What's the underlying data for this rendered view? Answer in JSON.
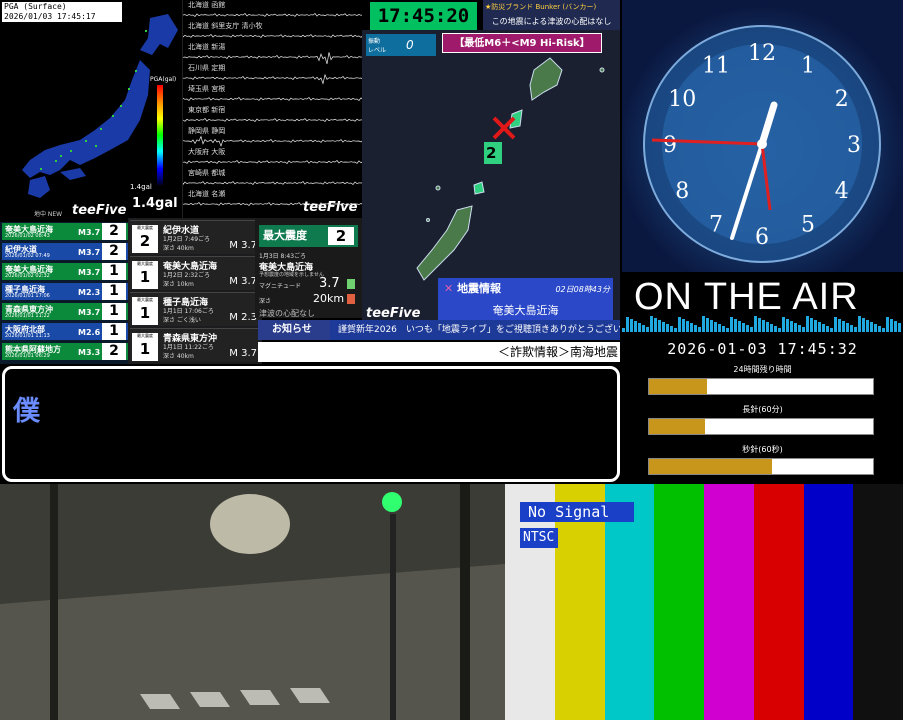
{
  "pga": {
    "label": "PGA (Surface)",
    "datetime": "2026/01/03 17:45:17",
    "scale_title": "PGA(gal)",
    "small_value": "1.4gal",
    "value": "1.4gal",
    "logo": "teeFive",
    "logo_prefix": "地中 NEW"
  },
  "waves": {
    "stations": [
      "北海道 函館",
      "北海道 斜里支庁 清小牧",
      "北海道 新湯",
      "石川県 定期",
      "埼玉県 宮根",
      "東京都 新宿",
      "静岡県 静岡",
      "大阪府 大阪",
      "宮崎県 都城",
      "北海道 名瀬"
    ],
    "logo": "teeFive"
  },
  "eq_list": [
    {
      "name": "奄美大島近海",
      "dt": "2026/01/02 08:43",
      "mag": "M3.7",
      "int": "2"
    },
    {
      "name": "紀伊水道",
      "dt": "2026/01/02 07:49",
      "mag": "M3.7",
      "int": "2"
    },
    {
      "name": "奄美大島近海",
      "dt": "2026/01/02 02:32",
      "mag": "M3.7",
      "int": "1"
    },
    {
      "name": "種子島近海",
      "dt": "2026/01/01 17:06",
      "mag": "M2.3",
      "int": "1"
    },
    {
      "name": "青森県東方沖",
      "dt": "2026/01/01 11:22",
      "mag": "M3.7",
      "int": "1"
    },
    {
      "name": "大阪府北部",
      "dt": "2026/01/01 11:13",
      "mag": "M2.6",
      "int": "1"
    },
    {
      "name": "熊本県阿蘇地方",
      "dt": "2026/01/01 06:29",
      "mag": "M3.3",
      "int": "2"
    }
  ],
  "eq_detail": [
    {
      "box_label": "最大震度",
      "int": "2",
      "name": "紀伊水道",
      "time": "1月2日 7:49ごろ",
      "depth": "深さ 40km",
      "mag": "M 3.7"
    },
    {
      "box_label": "最大震度",
      "int": "1",
      "name": "奄美大島近海",
      "time": "1月2日 2:32ごろ",
      "depth": "深さ 10km",
      "mag": "M 3.7"
    },
    {
      "box_label": "最大震度",
      "int": "1",
      "name": "種子島近海",
      "time": "1月1日 17:06ごろ",
      "depth": "深さ ごく浅い",
      "mag": "M 2.3"
    },
    {
      "box_label": "最大震度",
      "int": "1",
      "name": "青森県東方沖",
      "time": "1月1日 11:22ごろ",
      "depth": "深さ 40km",
      "mag": "M 3.7"
    }
  ],
  "max_panel": {
    "label": "最大震度",
    "int": "2",
    "time": "1月3日 8:43ごろ",
    "name": "奄美大島近海",
    "tsunami": "予想震度の地域を示しません",
    "mag_label": "マグニチュード",
    "mag": "3.7",
    "depth_label": "深さ",
    "depth": "20km",
    "footer": "津波の心配なし"
  },
  "center": {
    "clock": "17:45:20",
    "banner_line1": "★防災ブランド Bunker (バンカー)",
    "banner_line2": "この地震による津波の心配はなし",
    "risk": "【最低M6＋<M9 Hi-Risk】",
    "level_label": "振動\nレベル",
    "level_value": "0",
    "marker_int": "2",
    "logo": "teeFive",
    "info_title": "地震情報",
    "info_time": "02日08時43分",
    "info_place": "奄美大島近海"
  },
  "ticker": {
    "label": "お知らせ",
    "text": "謹賀新年2026　いつも「地震ライブ」をご視聴頂きありがとうございます!",
    "fraud": "＜詐欺情報＞南海地震"
  },
  "textbox": {
    "text": "僕"
  },
  "clock_panel": {
    "numerals": [
      "12",
      "1",
      "2",
      "3",
      "4",
      "5",
      "6",
      "7",
      "8",
      "9",
      "10",
      "11"
    ]
  },
  "onair": {
    "text": "ON THE AIR",
    "datetime": "2026-01-03 17:45:32"
  },
  "bars": [
    {
      "label": "24時間残り時間",
      "fill": 0.26
    },
    {
      "label": "長針(60分)",
      "fill": 0.25
    },
    {
      "label": "秒針(60秒)",
      "fill": 0.55
    }
  ],
  "colorbars": {
    "no_signal": "No Signal",
    "ntsc": "NTSC",
    "colors": [
      "#e8e8e8",
      "#d8d000",
      "#00c8c8",
      "#00c000",
      "#d000d0",
      "#d80000",
      "#0000c8",
      "#101010"
    ]
  }
}
